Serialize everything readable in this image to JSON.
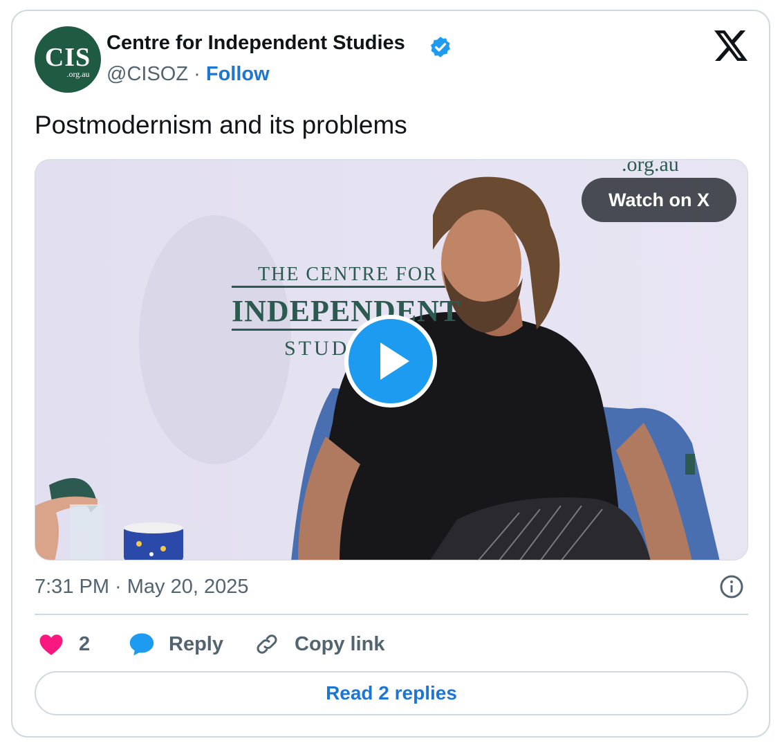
{
  "account": {
    "avatar_text": "CIS",
    "avatar_subtext": ".org.au",
    "name": "Centre for Independent Studies",
    "handle": "@CISOZ",
    "separator": "·",
    "follow_label": "Follow"
  },
  "tweet": {
    "text": "Postmodernism and its problems",
    "timestamp": "7:31 PM · May 20, 2025"
  },
  "media": {
    "watch_label": "Watch on X",
    "backdrop": {
      "line_top": ".org.au",
      "line1": "THE CENTRE FOR",
      "line2": "INDEPENDENT",
      "line3": "STUDIES"
    }
  },
  "actions": {
    "like_count": "2",
    "reply_label": "Reply",
    "copy_label": "Copy link"
  },
  "read_replies_label": "Read 2 replies",
  "icons": {
    "verified": "verified-badge-icon",
    "x_logo": "x-logo-icon",
    "play": "play-icon",
    "info": "info-icon",
    "heart": "heart-icon",
    "reply": "reply-bubble-icon",
    "link": "link-icon"
  },
  "colors": {
    "accent": "#1d9bf0",
    "link": "#1d75d4",
    "like": "#f91880",
    "muted": "#536471",
    "avatar_bg": "#1f5a43"
  }
}
